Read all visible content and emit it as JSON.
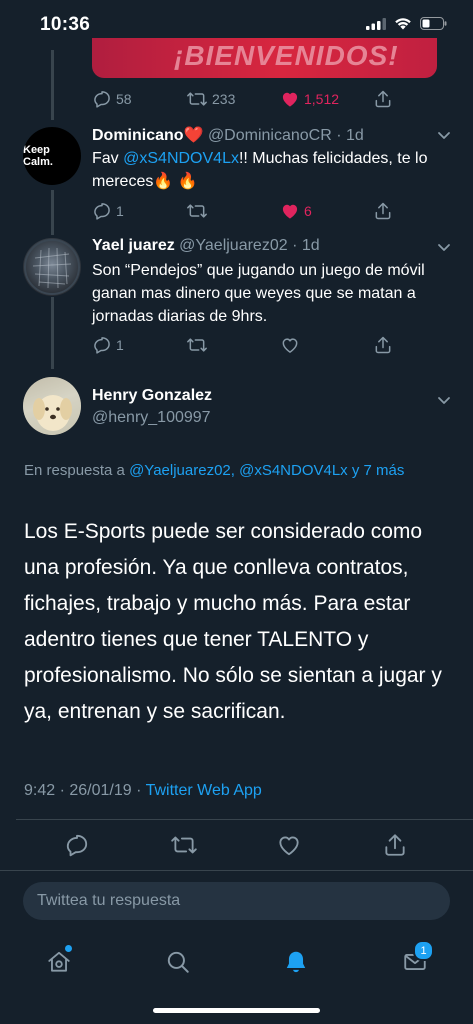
{
  "status_bar": {
    "time": "10:36"
  },
  "banner": {
    "text": "¡BIENVENIDOS!"
  },
  "prev_tweet_actions": {
    "replies": "58",
    "retweets": "233",
    "likes": "1,512"
  },
  "tweets": [
    {
      "name": "Dominicano❤️",
      "handle": "@DominicanoCR",
      "time": "· 1d",
      "avatar_text": "Keep Calm.",
      "text_prefix": "Fav ",
      "mention": "@xS4NDOV4Lx",
      "text_suffix": "!! Muchas felicidades, te lo mereces🔥 🔥",
      "replies": "1",
      "retweets": "",
      "likes": "6"
    },
    {
      "name": "Yael juarez",
      "handle": "@Yaeljuarez02",
      "time": "· 1d",
      "text": "Son “Pendejos” que jugando un juego de móvil ganan mas dinero que weyes que se matan a jornadas diarias de 9hrs.",
      "replies": "1",
      "retweets": "",
      "likes": ""
    }
  ],
  "main_tweet": {
    "name": "Henry Gonzalez",
    "handle": "@henry_100997",
    "reply_prefix": "En respuesta a ",
    "reply_mentions": "@Yaeljuarez02, @xS4NDOV4Lx y 7 más",
    "text": "Los E-Sports puede ser considerado como una profesión. Ya que conlleva contratos, fichajes, trabajo y mucho más. Para estar adentro tienes que tener TALENTO y profesionalismo. No sólo se sientan a jugar y ya, entrenan y se sacrifican.",
    "timestamp": "9:42 · 26/01/19 · ",
    "source": "Twitter Web App"
  },
  "reply_box": {
    "placeholder": "Twittea tu respuesta"
  },
  "tabs": {
    "messages_badge": "1"
  },
  "colors": {
    "background": "#15202b",
    "accent": "#1da1f2",
    "like": "#e0245e",
    "muted": "#8899a6"
  }
}
